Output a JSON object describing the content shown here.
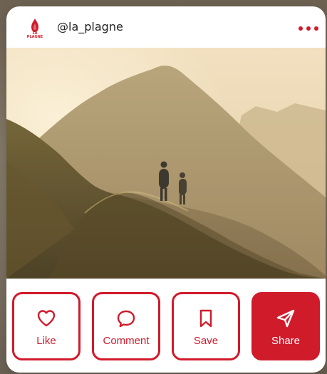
{
  "post": {
    "handle": "@la_plagne",
    "logo_text": "LA PLAGNE",
    "menu_icon": "more-dots-icon",
    "image_icon": "mountain-photo"
  },
  "actions": [
    {
      "label": "Like",
      "icon": "heart-icon"
    },
    {
      "label": "Comment",
      "icon": "comment-icon"
    },
    {
      "label": "Save",
      "icon": "bookmark-icon"
    },
    {
      "label": "Share",
      "icon": "send-icon"
    }
  ],
  "colors": {
    "accent": "#d01b2b",
    "card": "#ffffff",
    "text": "#222222"
  }
}
